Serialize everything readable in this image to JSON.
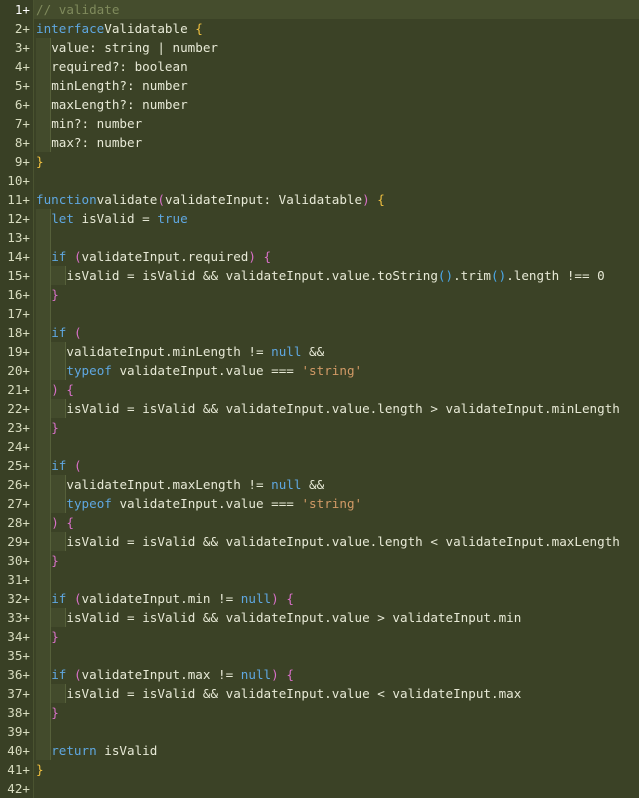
{
  "editor": {
    "language": "typescript",
    "lines": [
      {
        "n": "1+",
        "indent": 0,
        "tokens": [
          [
            "cm",
            "// validate"
          ]
        ]
      },
      {
        "n": "2+",
        "indent": 0,
        "tokens": [
          [
            "kw",
            "interface"
          ],
          [
            "",
            "Validatable "
          ],
          [
            "pn1",
            "{"
          ]
        ]
      },
      {
        "n": "3+",
        "indent": 1,
        "tokens": [
          [
            "",
            "value: string | number"
          ]
        ]
      },
      {
        "n": "4+",
        "indent": 1,
        "tokens": [
          [
            "",
            "required?: boolean"
          ]
        ]
      },
      {
        "n": "5+",
        "indent": 1,
        "tokens": [
          [
            "",
            "minLength?: number"
          ]
        ]
      },
      {
        "n": "6+",
        "indent": 1,
        "tokens": [
          [
            "",
            "maxLength?: number"
          ]
        ]
      },
      {
        "n": "7+",
        "indent": 1,
        "tokens": [
          [
            "",
            "min?: number"
          ]
        ]
      },
      {
        "n": "8+",
        "indent": 1,
        "tokens": [
          [
            "",
            "max?: number"
          ]
        ]
      },
      {
        "n": "9+",
        "indent": 0,
        "tokens": [
          [
            "pn1",
            "}"
          ]
        ]
      },
      {
        "n": "10+",
        "indent": 0,
        "tokens": []
      },
      {
        "n": "11+",
        "indent": 0,
        "tokens": [
          [
            "kw",
            "function"
          ],
          [
            "",
            "validate"
          ],
          [
            "pn2",
            "("
          ],
          [
            "",
            "validateInput: Validatable"
          ],
          [
            "pn2",
            ")"
          ],
          [
            "",
            " "
          ],
          [
            "pn1",
            "{"
          ]
        ]
      },
      {
        "n": "12+",
        "indent": 1,
        "tokens": [
          [
            "kw",
            "let"
          ],
          [
            "",
            " isValid = "
          ],
          [
            "kw",
            "true"
          ]
        ]
      },
      {
        "n": "13+",
        "indent": 1,
        "tokens": []
      },
      {
        "n": "14+",
        "indent": 1,
        "tokens": [
          [
            "kw",
            "if"
          ],
          [
            "",
            " "
          ],
          [
            "pn2",
            "("
          ],
          [
            "",
            "validateInput.required"
          ],
          [
            "pn2",
            ")"
          ],
          [
            "",
            " "
          ],
          [
            "pn2",
            "{"
          ]
        ]
      },
      {
        "n": "15+",
        "indent": 2,
        "tokens": [
          [
            "",
            "isValid = isValid && validateInput.value.toString"
          ],
          [
            "pn3",
            "()"
          ],
          [
            "",
            ".trim"
          ],
          [
            "pn3",
            "()"
          ],
          [
            "",
            ".length !== 0"
          ]
        ]
      },
      {
        "n": "16+",
        "indent": 1,
        "tokens": [
          [
            "pn2",
            "}"
          ]
        ]
      },
      {
        "n": "17+",
        "indent": 1,
        "tokens": []
      },
      {
        "n": "18+",
        "indent": 1,
        "tokens": [
          [
            "kw",
            "if"
          ],
          [
            "",
            " "
          ],
          [
            "pn2",
            "("
          ]
        ]
      },
      {
        "n": "19+",
        "indent": 2,
        "tokens": [
          [
            "",
            "validateInput.minLength != "
          ],
          [
            "kw",
            "null"
          ],
          [
            "",
            " &&"
          ]
        ]
      },
      {
        "n": "20+",
        "indent": 2,
        "tokens": [
          [
            "kw",
            "typeof"
          ],
          [
            "",
            " validateInput.value === "
          ],
          [
            "str",
            "'string'"
          ]
        ]
      },
      {
        "n": "21+",
        "indent": 1,
        "tokens": [
          [
            "pn2",
            ")"
          ],
          [
            "",
            " "
          ],
          [
            "pn2",
            "{"
          ]
        ]
      },
      {
        "n": "22+",
        "indent": 2,
        "tokens": [
          [
            "",
            "isValid = isValid && validateInput.value.length > validateInput.minLength"
          ]
        ]
      },
      {
        "n": "23+",
        "indent": 1,
        "tokens": [
          [
            "pn2",
            "}"
          ]
        ]
      },
      {
        "n": "24+",
        "indent": 1,
        "tokens": []
      },
      {
        "n": "25+",
        "indent": 1,
        "tokens": [
          [
            "kw",
            "if"
          ],
          [
            "",
            " "
          ],
          [
            "pn2",
            "("
          ]
        ]
      },
      {
        "n": "26+",
        "indent": 2,
        "tokens": [
          [
            "",
            "validateInput.maxLength != "
          ],
          [
            "kw",
            "null"
          ],
          [
            "",
            " &&"
          ]
        ]
      },
      {
        "n": "27+",
        "indent": 2,
        "tokens": [
          [
            "kw",
            "typeof"
          ],
          [
            "",
            " validateInput.value === "
          ],
          [
            "str",
            "'string'"
          ]
        ]
      },
      {
        "n": "28+",
        "indent": 1,
        "tokens": [
          [
            "pn2",
            ")"
          ],
          [
            "",
            " "
          ],
          [
            "pn2",
            "{"
          ]
        ]
      },
      {
        "n": "29+",
        "indent": 2,
        "tokens": [
          [
            "",
            "isValid = isValid && validateInput.value.length < validateInput.maxLength"
          ]
        ]
      },
      {
        "n": "30+",
        "indent": 1,
        "tokens": [
          [
            "pn2",
            "}"
          ]
        ]
      },
      {
        "n": "31+",
        "indent": 1,
        "tokens": []
      },
      {
        "n": "32+",
        "indent": 1,
        "tokens": [
          [
            "kw",
            "if"
          ],
          [
            "",
            " "
          ],
          [
            "pn2",
            "("
          ],
          [
            "",
            "validateInput.min != "
          ],
          [
            "kw",
            "null"
          ],
          [
            "pn2",
            ")"
          ],
          [
            "",
            " "
          ],
          [
            "pn2",
            "{"
          ]
        ]
      },
      {
        "n": "33+",
        "indent": 2,
        "tokens": [
          [
            "",
            "isValid = isValid && validateInput.value > validateInput.min"
          ]
        ]
      },
      {
        "n": "34+",
        "indent": 1,
        "tokens": [
          [
            "pn2",
            "}"
          ]
        ]
      },
      {
        "n": "35+",
        "indent": 1,
        "tokens": []
      },
      {
        "n": "36+",
        "indent": 1,
        "tokens": [
          [
            "kw",
            "if"
          ],
          [
            "",
            " "
          ],
          [
            "pn2",
            "("
          ],
          [
            "",
            "validateInput.max != "
          ],
          [
            "kw",
            "null"
          ],
          [
            "pn2",
            ")"
          ],
          [
            "",
            " "
          ],
          [
            "pn2",
            "{"
          ]
        ]
      },
      {
        "n": "37+",
        "indent": 2,
        "tokens": [
          [
            "",
            "isValid = isValid && validateInput.value < validateInput.max"
          ]
        ]
      },
      {
        "n": "38+",
        "indent": 1,
        "tokens": [
          [
            "pn2",
            "}"
          ]
        ]
      },
      {
        "n": "39+",
        "indent": 1,
        "tokens": []
      },
      {
        "n": "40+",
        "indent": 1,
        "tokens": [
          [
            "kw",
            "return"
          ],
          [
            "",
            " isValid"
          ]
        ]
      },
      {
        "n": "41+",
        "indent": 0,
        "tokens": [
          [
            "pn1",
            "}"
          ]
        ]
      },
      {
        "n": "42+",
        "indent": 0,
        "tokens": []
      }
    ]
  },
  "colors": {
    "background": "#3b4226",
    "keyword": "#5fa7e0",
    "comment": "#7f8a5c",
    "string": "#d19a66",
    "brace_level1": "#f0c040",
    "brace_level2": "#d870c8",
    "paren_call": "#4aa8e8"
  }
}
